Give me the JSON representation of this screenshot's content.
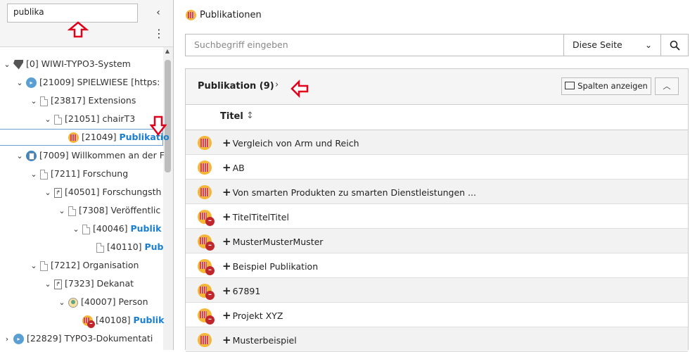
{
  "tree_filter": {
    "value": "publika"
  },
  "tree": [
    {
      "label": "[0] WIWI-TYPO3-System"
    },
    {
      "label": "[21009] SPIELWIESE [https:"
    },
    {
      "label": "[23817] Extensions"
    },
    {
      "label": "[21051] chairT3"
    },
    {
      "prefix": "[21049] ",
      "match": "Publikatio"
    },
    {
      "label": "[7009] Willkommen an der F"
    },
    {
      "label": "[7211] Forschung"
    },
    {
      "label": "[40501] Forschungsth"
    },
    {
      "label": "[7308] Veröffentlic"
    },
    {
      "prefix": "[40046] ",
      "match": "Publik"
    },
    {
      "prefix": "[40110] ",
      "match": "Pub"
    },
    {
      "label": "[7212] Organisation"
    },
    {
      "label": "[7323] Dekanat"
    },
    {
      "label": "[40007] Person"
    },
    {
      "prefix": "[40108] ",
      "match": "Publik"
    },
    {
      "label": "[22829] TYPO3-Dokumentati"
    }
  ],
  "header": {
    "title": "Publikationen"
  },
  "search": {
    "placeholder": "Suchbegriff eingeben",
    "scope": "Diese Seite"
  },
  "panel": {
    "title": "Publikation (9)",
    "columns_button": "Spalten anzeigen",
    "column_title": "Titel"
  },
  "records": [
    {
      "title": "Vergleich von Arm und Reich",
      "hidden": false
    },
    {
      "title": "AB",
      "hidden": false
    },
    {
      "title": "Von smarten Produkten zu smarten Dienstleistungen ...",
      "hidden": false
    },
    {
      "title": "TitelTitelTitel",
      "hidden": true
    },
    {
      "title": "MusterMusterMuster",
      "hidden": true
    },
    {
      "title": "Beispiel Publikation",
      "hidden": true
    },
    {
      "title": "67891",
      "hidden": true
    },
    {
      "title": "Projekt XYZ",
      "hidden": true
    },
    {
      "title": "Musterbeispiel",
      "hidden": false
    }
  ],
  "colors": {
    "accent": "#1a7fcf",
    "annotation": "#e0001a"
  }
}
